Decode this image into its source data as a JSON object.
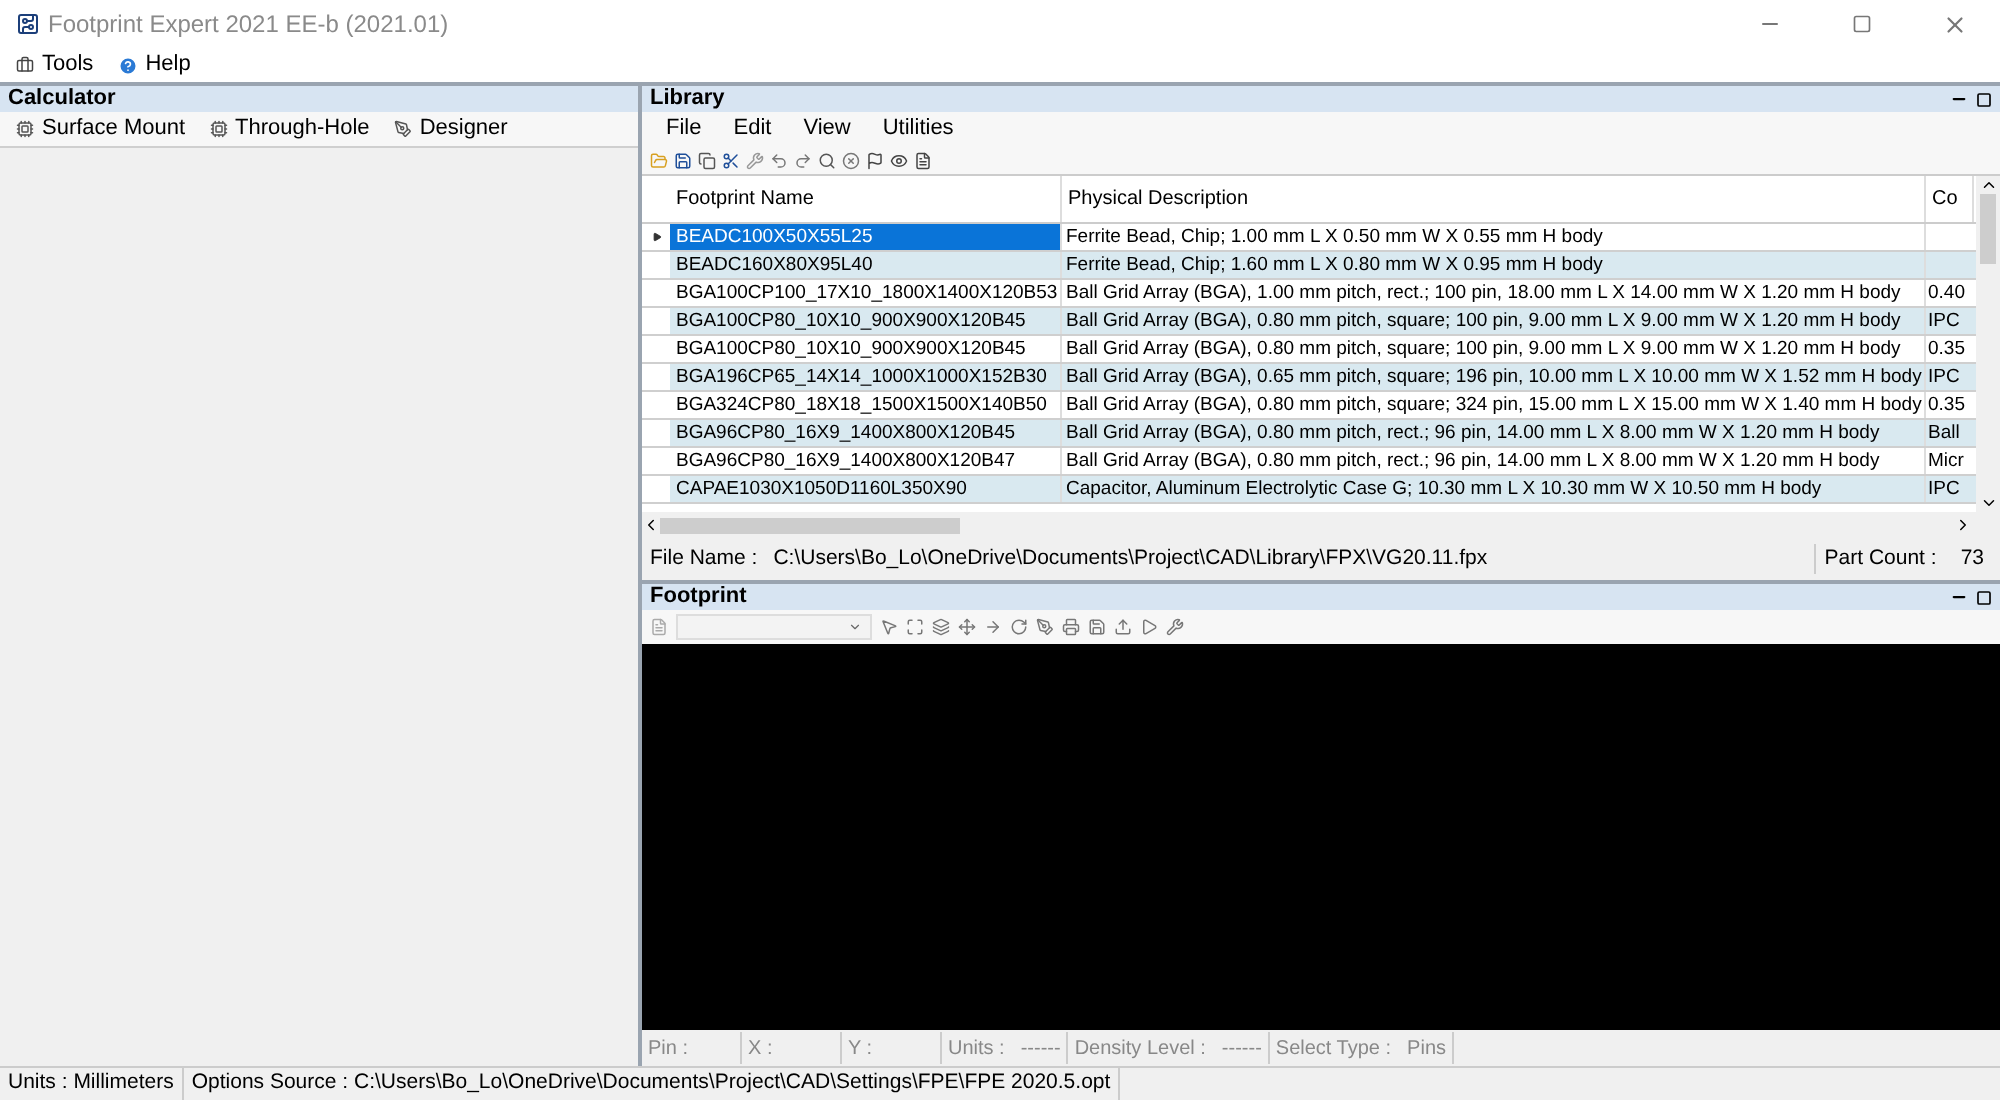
{
  "window": {
    "title": "Footprint Expert 2021 EE-b (2021.01)"
  },
  "menu": [
    "Tools",
    "Help"
  ],
  "calculator": {
    "title": "Calculator",
    "tabs": [
      "Surface Mount",
      "Through-Hole",
      "Designer"
    ]
  },
  "library": {
    "title": "Library",
    "menu": [
      "File",
      "Edit",
      "View",
      "Utilities"
    ],
    "columns": [
      "Footprint Name",
      "Physical Description",
      "Co"
    ],
    "rows": [
      {
        "name": "BEADC100X50X55L25",
        "description": "Ferrite Bead, Chip; 1.00 mm L X 0.50 mm W X 0.55 mm H body",
        "selected": true
      },
      {
        "name": "BEADC160X80X95L40",
        "description": "Ferrite Bead, Chip; 1.60 mm L X 0.80 mm W X 0.95 mm H body",
        "selected": false
      },
      {
        "name": "BGA100CP100_17X10_1800X1400X120B53",
        "description": "Ball Grid Array (BGA), 1.00 mm pitch, rect.; 100 pin, 18.00 mm L X 14.00 mm W X 1.20 mm H body",
        "column_3": "0.40",
        "selected": false
      },
      {
        "name": "BGA100CP80_10X10_900X900X120B45",
        "description": "Ball Grid Array (BGA), 0.80 mm pitch, square; 100 pin, 9.00 mm L X 9.00 mm W X 1.20 mm H body",
        "column_3": "IPC",
        "selected": false
      },
      {
        "name": "BGA100CP80_10X10_900X900X120B45",
        "description": "Ball Grid Array (BGA), 0.80 mm pitch, square; 100 pin, 9.00 mm L X 9.00 mm W X 1.20 mm H body",
        "column_3": "0.35",
        "selected": false
      },
      {
        "name": "BGA196CP65_14X14_1000X1000X152B30",
        "description": "Ball Grid Array (BGA), 0.65 mm pitch, square; 196 pin, 10.00 mm L X 10.00 mm W X 1.52 mm H body",
        "column_3": "IPC",
        "selected": false
      },
      {
        "name": "BGA324CP80_18X18_1500X1500X140B50",
        "description": "Ball Grid Array (BGA), 0.80 mm pitch, square; 324 pin, 15.00 mm L X 15.00 mm W X 1.40 mm H body",
        "column_3": "0.35",
        "selected": false
      },
      {
        "name": "BGA96CP80_16X9_1400X800X120B45",
        "description": "Ball Grid Array (BGA), 0.80 mm pitch, rect.; 96 pin, 14.00 mm L X 8.00 mm W X 1.20 mm H body",
        "column_3": "Ball",
        "selected": false
      },
      {
        "name": "BGA96CP80_16X9_1400X800X120B47",
        "description": "Ball Grid Array (BGA), 0.80 mm pitch, rect.; 96 pin, 14.00 mm L X 8.00 mm W X 1.20 mm H body",
        "column_3": "Micr",
        "selected": false
      },
      {
        "name": "CAPAE1030X1050D1160L350X90",
        "description": "Capacitor, Aluminum Electrolytic Case G; 10.30 mm L X 10.30 mm W X 10.50 mm H body",
        "column_3": "IPC",
        "selected": false
      }
    ],
    "file_label": "File Name :",
    "file_path": "C:\\Users\\Bo_Lo\\OneDrive\\Documents\\Project\\CAD\\Library\\FPX\\VG20.11.fpx",
    "count_label": "Part Count :",
    "count": "73"
  },
  "footprint": {
    "title": "Footprint",
    "status": [
      {
        "label": "Pin :"
      },
      {
        "label": "X :"
      },
      {
        "label": "Y :"
      },
      {
        "label": "Units :",
        "value": "------"
      },
      {
        "label": "Density Level :",
        "value": "------"
      },
      {
        "label": "Select Type :",
        "value": "Pins"
      }
    ]
  },
  "status_bar": [
    {
      "label": "Units :",
      "value": "Millimeters"
    },
    {
      "label": "Options Source :",
      "value": "C:\\Users\\Bo_Lo\\OneDrive\\Documents\\Project\\CAD\\Settings\\FPE\\FPE 2020.5.opt"
    }
  ]
}
